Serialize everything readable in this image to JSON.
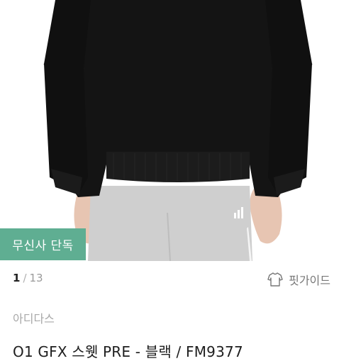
{
  "product": {
    "image_alt": "black sweatshirt on model",
    "badge": "무신사 단독",
    "pager": {
      "current": "1",
      "total": "13"
    },
    "fit_guide_label": "핏가이드",
    "fit_guide_icon": "sweater-icon",
    "brand": "아디다스",
    "title": "O1 GFX 스웻 PRE - 블랙 / FM9377"
  },
  "colors": {
    "badge_bg": "#5fae92",
    "sweatshirt": "#141414",
    "pants": "#cfcfcf",
    "skin": "#e8c7b4"
  }
}
